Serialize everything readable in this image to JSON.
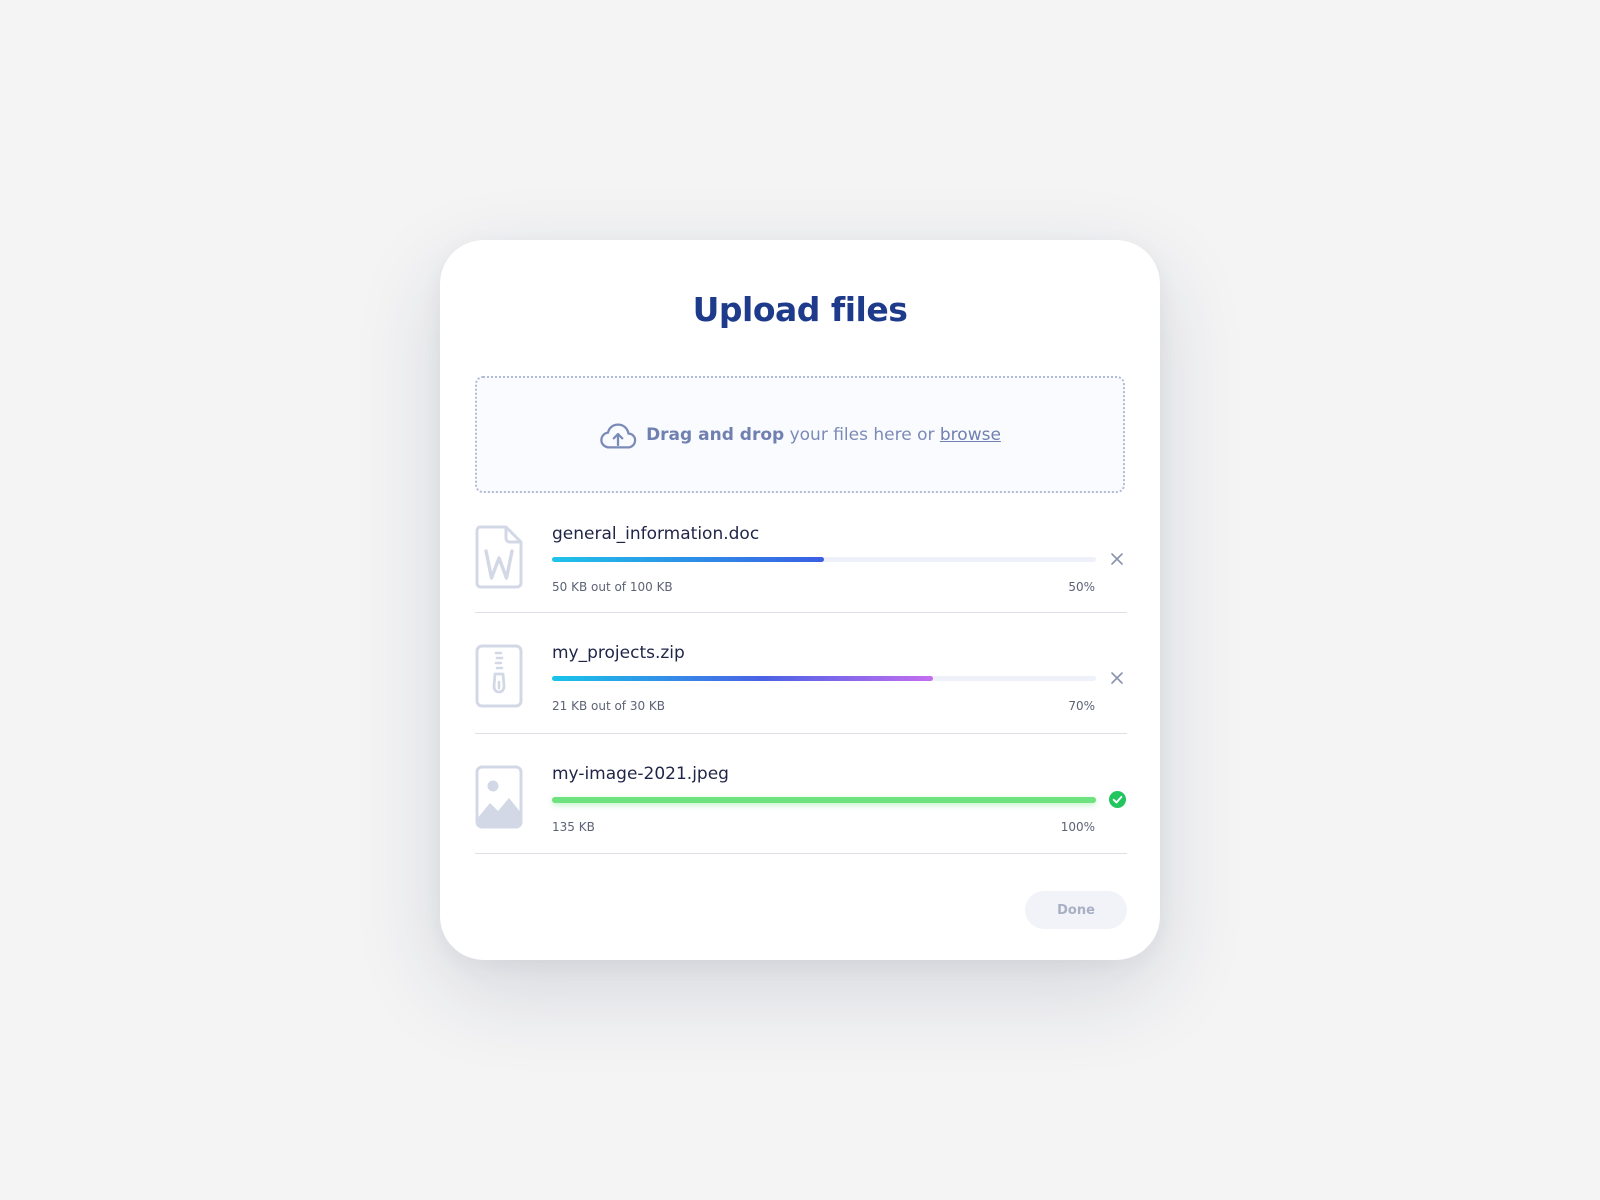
{
  "modal": {
    "title": "Upload files"
  },
  "dropzone": {
    "strong_text": "Drag and drop",
    "middle_text": "your files here or",
    "link_text": "browse",
    "icon": "cloud-upload-icon"
  },
  "files": [
    {
      "name": "general_information.doc",
      "size_text": "50 KB out of 100 KB",
      "percent_text": "50%",
      "progress_percent": 50,
      "icon": "word-document-icon",
      "action": "remove-icon",
      "status": "uploading"
    },
    {
      "name": "my_projects.zip",
      "size_text": "21 KB out of 30 KB",
      "percent_text": "70%",
      "progress_percent": 70,
      "icon": "zip-archive-icon",
      "action": "remove-icon",
      "status": "uploading"
    },
    {
      "name": "my-image-2021.jpeg",
      "size_text": "135 KB",
      "percent_text": "100%",
      "progress_percent": 100,
      "icon": "image-file-icon",
      "action": "check-circle-icon",
      "status": "complete"
    }
  ],
  "footer": {
    "done_label": "Done"
  },
  "colors": {
    "title": "#1e3a8a",
    "progress_blue_start": "#1ec3ea",
    "progress_blue_end": "#3b5ee4",
    "progress_purple_end": "#c46ef0",
    "progress_green": "#6ee27e",
    "success": "#22c55e"
  }
}
